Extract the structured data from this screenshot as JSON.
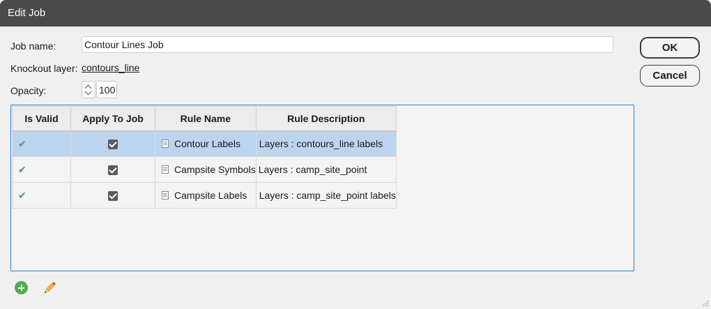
{
  "window": {
    "title": "Edit Job"
  },
  "form": {
    "job_name_label": "Job name:",
    "job_name_value": "Contour Lines Job",
    "knockout_label": "Knockout layer:",
    "knockout_value": "contours_line",
    "opacity_label": "Opacity:",
    "opacity_value": "100"
  },
  "buttons": {
    "ok": "OK",
    "cancel": "Cancel"
  },
  "table": {
    "columns": [
      "Is Valid",
      "Apply To Job",
      "Rule Name",
      "Rule Description"
    ],
    "rows": [
      {
        "valid": "✔",
        "apply": true,
        "name": "Contour Labels",
        "description": "Layers : contours_line labels",
        "selected": true
      },
      {
        "valid": "✔",
        "apply": true,
        "name": "Campsite Symbols",
        "description": "Layers : camp_site_point",
        "selected": false
      },
      {
        "valid": "✔",
        "apply": true,
        "name": "Campsite Labels",
        "description": "Layers : camp_site_point labels",
        "selected": false
      }
    ]
  },
  "icons": [
    "add-rule-icon",
    "edit-rule-icon",
    "resize-grip-icon",
    "document-icon",
    "checkmark-icon"
  ],
  "colors": {
    "titlebar": "#4a4a4a",
    "selection": "#bcd5ef",
    "accent_border": "#2a7fd4",
    "valid_green": "#3ea24a",
    "add_green": "#4fae4a"
  }
}
